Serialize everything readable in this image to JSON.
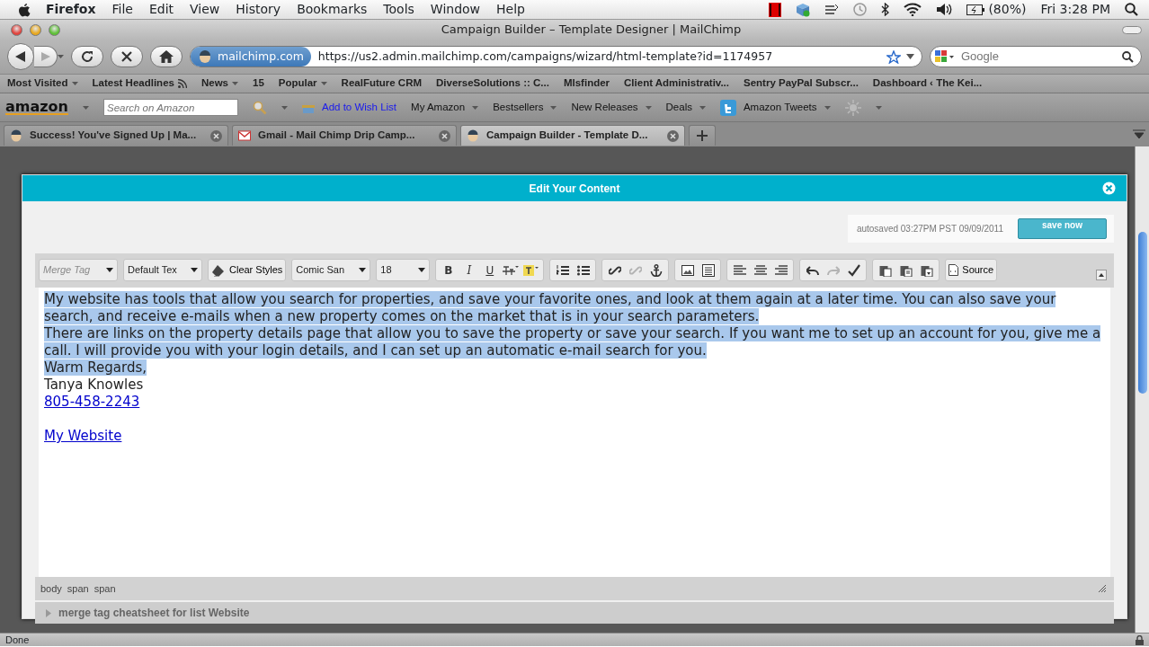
{
  "menubar": {
    "app": "Firefox",
    "menus": [
      "File",
      "Edit",
      "View",
      "History",
      "Bookmarks",
      "Tools",
      "Window",
      "Help"
    ],
    "battery": "(80%)",
    "clock": "Fri 3:28 PM"
  },
  "window": {
    "title": "Campaign Builder – Template Designer | MailChimp"
  },
  "navigation": {
    "site": "mailchimp.com",
    "url": "https://us2.admin.mailchimp.com/campaigns/wizard/html-template?id=1174957",
    "search_placeholder": "Google"
  },
  "bookmarks": [
    {
      "label": "Most Visited",
      "kind": "menu"
    },
    {
      "label": "Latest Headlines",
      "kind": "feed"
    },
    {
      "label": "News",
      "kind": "menu"
    },
    {
      "label": "15",
      "kind": "link"
    },
    {
      "label": "Popular",
      "kind": "menu"
    },
    {
      "label": "RealFuture CRM",
      "kind": "link"
    },
    {
      "label": "DiverseSolutions :: C...",
      "kind": "link"
    },
    {
      "label": "Mlsfinder",
      "kind": "link"
    },
    {
      "label": "Client Administrativ...",
      "kind": "link"
    },
    {
      "label": "Sentry PayPal Subscr...",
      "kind": "link"
    },
    {
      "label": "Dashboard ‹ The Kei...",
      "kind": "link"
    }
  ],
  "amazon_toolbar": {
    "logo": "amazon",
    "search_placeholder": "Search on Amazon",
    "items": [
      {
        "label": "Add to Wish List",
        "kind": "wishlist"
      },
      {
        "label": "My Amazon",
        "kind": "menu"
      },
      {
        "label": "Bestsellers",
        "kind": "menu"
      },
      {
        "label": "New Releases",
        "kind": "menu"
      },
      {
        "label": "Deals",
        "kind": "menu"
      },
      {
        "label": "Amazon Tweets",
        "kind": "tweets"
      }
    ]
  },
  "tabs": [
    {
      "label": "Success! You've Signed Up | Ma...",
      "selected": false
    },
    {
      "label": "Gmail - Mail Chimp Drip Camp...",
      "selected": false
    },
    {
      "label": "Campaign Builder - Template D...",
      "selected": true
    }
  ],
  "dialog": {
    "title": "Edit Your Content",
    "autosave": "autosaved 03:27PM PST 09/09/2011",
    "save_button": "save now",
    "toolbar": [
      [
        {
          "kind": "select",
          "text": "Merge Tag",
          "placeholder": true
        }
      ],
      [
        {
          "kind": "select",
          "text": "Default Tex",
          "placeholder": false
        }
      ],
      [
        {
          "kind": "button",
          "text": "Clear Styles"
        }
      ],
      [
        {
          "kind": "select",
          "text": "Comic San",
          "placeholder": false
        }
      ],
      [
        {
          "kind": "select",
          "text": "18",
          "placeholder": false
        }
      ],
      [
        {
          "kind": "glyph",
          "text": "B",
          "disabled": false
        },
        {
          "kind": "glyph",
          "text": "I",
          "disabled": false
        },
        {
          "kind": "glyph",
          "text": "U",
          "disabled": false
        },
        {
          "kind": "icon",
          "disabled": false
        },
        {
          "kind": "icon",
          "disabled": false
        }
      ],
      [
        {
          "kind": "icon",
          "disabled": false
        },
        {
          "kind": "icon",
          "disabled": false
        }
      ],
      [
        {
          "kind": "icon",
          "disabled": false
        },
        {
          "kind": "icon",
          "disabled": true
        },
        {
          "kind": "icon",
          "disabled": false
        }
      ],
      [
        {
          "kind": "icon",
          "disabled": false
        },
        {
          "kind": "icon",
          "disabled": false
        }
      ],
      [
        {
          "kind": "icon",
          "disabled": false
        },
        {
          "kind": "icon",
          "disabled": false
        },
        {
          "kind": "icon",
          "disabled": false
        }
      ],
      [
        {
          "kind": "icon",
          "disabled": false
        },
        {
          "kind": "icon",
          "disabled": true
        },
        {
          "kind": "icon",
          "disabled": false
        }
      ],
      [
        {
          "kind": "icon",
          "disabled": false
        },
        {
          "kind": "icon",
          "disabled": false
        },
        {
          "kind": "icon",
          "disabled": false
        }
      ],
      [
        {
          "kind": "button",
          "text": "Source"
        }
      ]
    ],
    "content": [
      {
        "kind": "text",
        "selected": true,
        "text": "My website has tools that allow you search for properties, and save your favorite ones, and look at them again at a later time. You can also save your search, and receive e-mails when a new property comes on the market that is in your search parameters."
      },
      {
        "kind": "text",
        "selected": true,
        "text": "There are links on the property details page that allow you to save the property or save your search. If you want me to set up an account for you, give me a call. I will provide you with your login details, and I can set up an automatic e-mail search for you."
      },
      {
        "kind": "text",
        "selected": true,
        "text": "Warm Regards,"
      },
      {
        "kind": "text",
        "selected": false,
        "text": "Tanya Knowles"
      },
      {
        "kind": "link",
        "selected": false,
        "text": "805-458-2243"
      },
      {
        "kind": "blank"
      },
      {
        "kind": "link",
        "selected": false,
        "text": "My Website"
      }
    ],
    "path": [
      "body",
      "span",
      "span"
    ],
    "cheatsheet": "merge tag cheatsheet for list Website"
  },
  "status_bar": "Done"
}
